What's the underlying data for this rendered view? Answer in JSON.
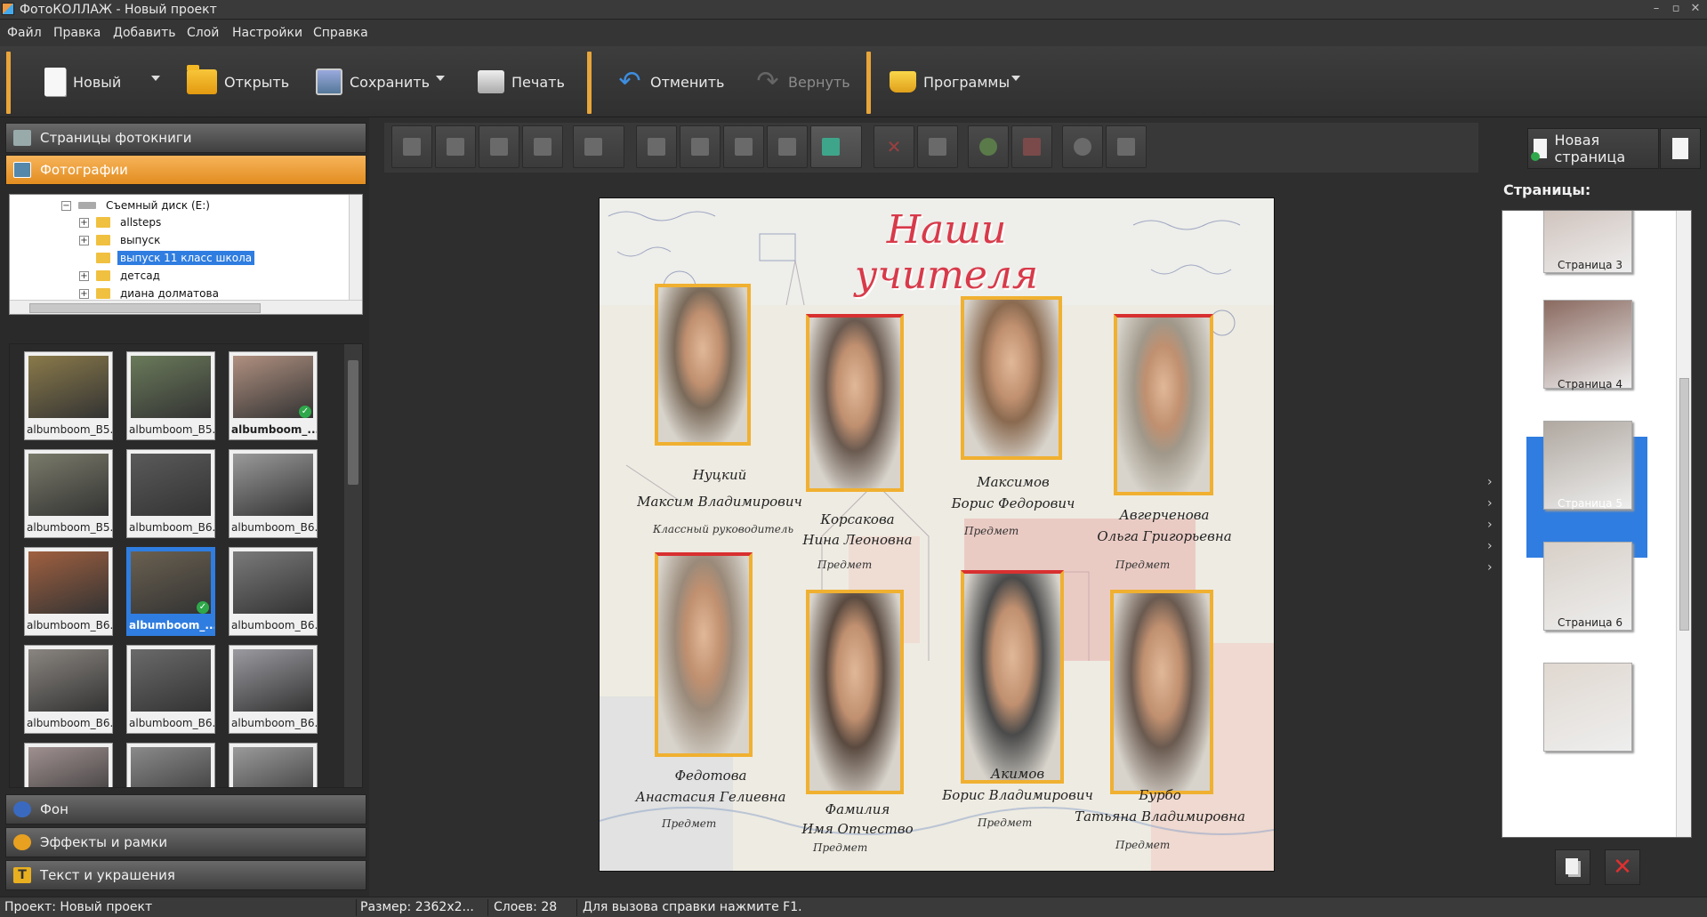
{
  "window": {
    "title": "ФотоКОЛЛАЖ - Новый проект",
    "controls": [
      "–",
      "▫",
      "✕"
    ]
  },
  "menu": [
    "Файл",
    "Правка",
    "Добавить",
    "Слой",
    "Настройки",
    "Справка"
  ],
  "toolbar": {
    "new": "Новый",
    "open": "Открыть",
    "save": "Сохранить",
    "print": "Печать",
    "undo": "Отменить",
    "redo": "Вернуть",
    "programs": "Программы"
  },
  "left_panel": {
    "sections": {
      "pages": "Страницы фотокниги",
      "photos": "Фотографии",
      "background": "Фон",
      "effects": "Эффекты и рамки",
      "text": "Текст и украшения"
    },
    "tree": [
      {
        "label": "Съемный диск (E:)",
        "expander": "−",
        "level": 0,
        "selected": false
      },
      {
        "label": "allsteps",
        "expander": "+",
        "level": 1,
        "selected": false
      },
      {
        "label": "выпуск",
        "expander": "+",
        "level": 1,
        "selected": false
      },
      {
        "label": "выпуск 11 класс школа",
        "expander": "",
        "level": 1,
        "selected": true
      },
      {
        "label": "детсад",
        "expander": "+",
        "level": 1,
        "selected": false
      },
      {
        "label": "диана долматова",
        "expander": "+",
        "level": 1,
        "selected": false
      }
    ],
    "thumbnails": [
      {
        "caption": "albumboom_B5...",
        "selected": false,
        "checked": false,
        "color": "#8a7a4a"
      },
      {
        "caption": "albumboom_B5...",
        "selected": false,
        "checked": false,
        "color": "#6a7a5a"
      },
      {
        "caption": "albumboom_...",
        "selected": false,
        "checked": true,
        "color": "#b09080",
        "bold": true
      },
      {
        "caption": "albumboom_B5...",
        "selected": false,
        "checked": false,
        "color": "#7a7a6a"
      },
      {
        "caption": "albumboom_B6...",
        "selected": false,
        "checked": false,
        "color": "#5a5a5a"
      },
      {
        "caption": "albumboom_B6...",
        "selected": false,
        "checked": false,
        "color": "#9a9a9a"
      },
      {
        "caption": "albumboom_B6...",
        "selected": false,
        "checked": false,
        "color": "#a06040"
      },
      {
        "caption": "albumboom_...",
        "selected": true,
        "checked": true,
        "color": "#6a6050"
      },
      {
        "caption": "albumboom_B6...",
        "selected": false,
        "checked": false,
        "color": "#7a7a7a"
      },
      {
        "caption": "albumboom_B6...",
        "selected": false,
        "checked": false,
        "color": "#8a8580"
      },
      {
        "caption": "albumboom_B6...",
        "selected": false,
        "checked": false,
        "color": "#6a6a6a"
      },
      {
        "caption": "albumboom_B6...",
        "selected": false,
        "checked": false,
        "color": "#9a9aa0"
      },
      {
        "caption": "",
        "selected": false,
        "checked": false,
        "color": "#a09090"
      },
      {
        "caption": "",
        "selected": false,
        "checked": false,
        "color": "#8a8a8a"
      },
      {
        "caption": "",
        "selected": false,
        "checked": false,
        "color": "#9a9a9a"
      }
    ]
  },
  "page": {
    "heading": "Наши учителя",
    "teachers": [
      {
        "name1": "Нуцкий",
        "name2": "Максим Владимирович",
        "sub": "Классный руководитель",
        "color": "#7a6a5a"
      },
      {
        "name1": "Корсакова",
        "name2": "Нина Леоновна",
        "sub": "Предмет",
        "color": "#6a5a50"
      },
      {
        "name1": "Максимов",
        "name2": "Борис Федорович",
        "sub": "Предмет",
        "color": "#8a6a50"
      },
      {
        "name1": "Авгерченова",
        "name2": "Ольга Григорьевна",
        "sub": "Предмет",
        "color": "#a0988a"
      },
      {
        "name1": "Федотова",
        "name2": "Анастасия Гелиевна",
        "sub": "Предмет",
        "color": "#9a8a7a"
      },
      {
        "name1": "Фамилия",
        "name2": "Имя Отчество",
        "sub": "Предмет",
        "color": "#5a4a40"
      },
      {
        "name1": "Акимов",
        "name2": "Борис Владимирович",
        "sub": "Предмет",
        "color": "#4a4a4a"
      },
      {
        "name1": "Бурбо",
        "name2": "Татьяна Владимировна",
        "sub": "Предмет",
        "color": "#6a5a50"
      }
    ]
  },
  "right_panel": {
    "new_page": "Новая страница",
    "pages_title": "Страницы:",
    "pages": [
      "Страница 3",
      "Страница 4",
      "Страница 5",
      "Страница 6",
      ""
    ],
    "selected_page": "Страница 5"
  },
  "status": {
    "project": "Проект:  Новый проект",
    "size": "Размер:  2362x2...",
    "layers": "Слоев:  28",
    "hint": "Для вызова справки нажмите F1."
  },
  "colors": {
    "accent": "#e8a53a",
    "selection": "#2f7de0",
    "heading_red": "#d83a4a",
    "frame_gold": "#f0b030"
  }
}
